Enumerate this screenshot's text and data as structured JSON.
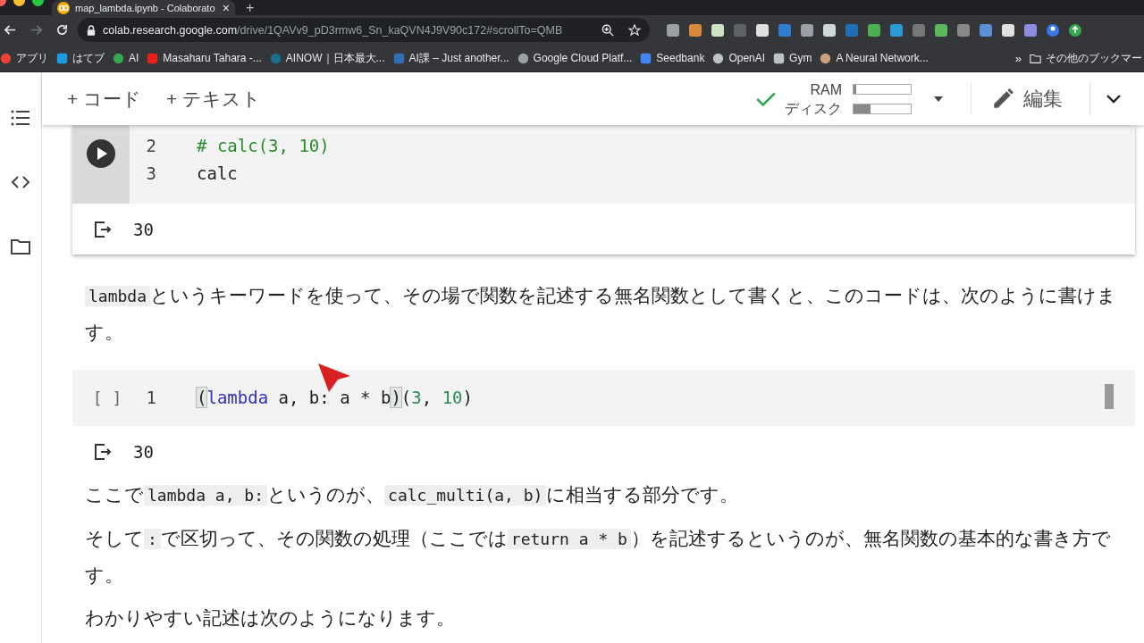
{
  "browser": {
    "tab": {
      "title": "map_lambda.ipynb - Colaborato",
      "close": "×",
      "new_tab": "+"
    },
    "url": {
      "host": "colab.research.google.com",
      "path": "/drive/1QAVv9_pD3rmw6_Sn_kaQVN4J9V90c172#scrollTo=QMB"
    },
    "bookmarks": [
      {
        "label": "アプリ"
      },
      {
        "label": "はてブ"
      },
      {
        "label": "AI"
      },
      {
        "label": "Masaharu Tahara -..."
      },
      {
        "label": "AINOW｜日本最大..."
      },
      {
        "label": "AI課 – Just another..."
      },
      {
        "label": "Google Cloud Platf..."
      },
      {
        "label": "Seedbank"
      },
      {
        "label": "OpenAI"
      },
      {
        "label": "Gym"
      },
      {
        "label": "A Neural Network..."
      }
    ],
    "more_bookmarks": "»",
    "other_bookmarks": "その他のブックマー"
  },
  "toolbar": {
    "add_code": "+ コード",
    "add_text": "+ テキスト",
    "ram": {
      "label": "RAM",
      "level": 0.05
    },
    "disk": {
      "label": "ディスク",
      "level": 0.3
    },
    "edit": "編集"
  },
  "cells": [
    {
      "kind": "code",
      "ran": true,
      "lines": [
        {
          "number": "2",
          "tokens": [
            {
              "t": "# calc(3, 10)",
              "kind": "comment"
            }
          ]
        },
        {
          "number": "3",
          "tokens": [
            {
              "t": "calc",
              "kind": "plain"
            }
          ]
        }
      ],
      "output": "30"
    },
    {
      "kind": "text",
      "paragraphs": [
        [
          {
            "t": "lambda",
            "kind": "code"
          },
          {
            "t": "というキーワードを使って、その場で関数を記述する無名関数として書くと、このコードは、次のように書けます。",
            "kind": "text"
          }
        ]
      ]
    },
    {
      "kind": "code",
      "ran": false,
      "run_label": "[ ]",
      "lines": [
        {
          "number": "1",
          "tokens": [
            {
              "t": "(",
              "kind": "bracket"
            },
            {
              "t": "lambda",
              "kind": "keyword"
            },
            {
              "t": " a, b: a * b",
              "kind": "plain"
            },
            {
              "t": ")",
              "kind": "bracket"
            },
            {
              "t": "(",
              "kind": "plain"
            },
            {
              "t": "3",
              "kind": "number"
            },
            {
              "t": ", ",
              "kind": "plain"
            },
            {
              "t": "10",
              "kind": "number"
            },
            {
              "t": ")",
              "kind": "plain"
            }
          ]
        }
      ],
      "output": "30"
    },
    {
      "kind": "text",
      "paragraphs": [
        [
          {
            "t": "ここで",
            "kind": "text"
          },
          {
            "t": "lambda a, b:",
            "kind": "code"
          },
          {
            "t": "というのが、",
            "kind": "text"
          },
          {
            "t": "calc_multi(a, b)",
            "kind": "code"
          },
          {
            "t": "に相当する部分です。",
            "kind": "text"
          }
        ],
        [
          {
            "t": "そして",
            "kind": "text"
          },
          {
            "t": ":",
            "kind": "code"
          },
          {
            "t": "で区切って、その関数の処理（ここでは",
            "kind": "text"
          },
          {
            "t": "return a * b",
            "kind": "code"
          },
          {
            "t": "）を記述するというのが、無名関数の基本的な書き方です。",
            "kind": "text"
          }
        ],
        [
          {
            "t": "わかりやすい記述は次のようになります。",
            "kind": "text"
          }
        ]
      ]
    }
  ]
}
